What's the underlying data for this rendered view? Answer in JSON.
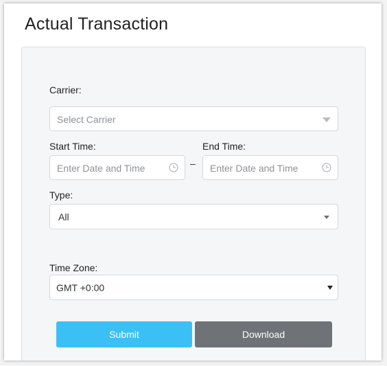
{
  "page": {
    "title": "Actual Transaction"
  },
  "form": {
    "carrier": {
      "label": "Carrier:",
      "placeholder": "Select Carrier"
    },
    "start_time": {
      "label": "Start Time:",
      "placeholder": "Enter Date and Time"
    },
    "separator": "–",
    "end_time": {
      "label": "End Time:",
      "placeholder": "Enter Date and Time"
    },
    "type": {
      "label": "Type:",
      "value": "All"
    },
    "time_zone": {
      "label": "Time Zone:",
      "value": "GMT +0:00"
    }
  },
  "actions": {
    "submit_label": "Submit",
    "download_label": "Download"
  },
  "colors": {
    "submit": "#3bc0f6",
    "download": "#6f7277",
    "panel_bg": "#f5f6f8"
  },
  "icons": {
    "carrier_dropdown": "chevron-down-icon",
    "start_time": "clock-icon",
    "end_time": "clock-icon",
    "type_dropdown": "chevron-down-icon",
    "time_zone_dropdown": "chevron-down-icon"
  }
}
